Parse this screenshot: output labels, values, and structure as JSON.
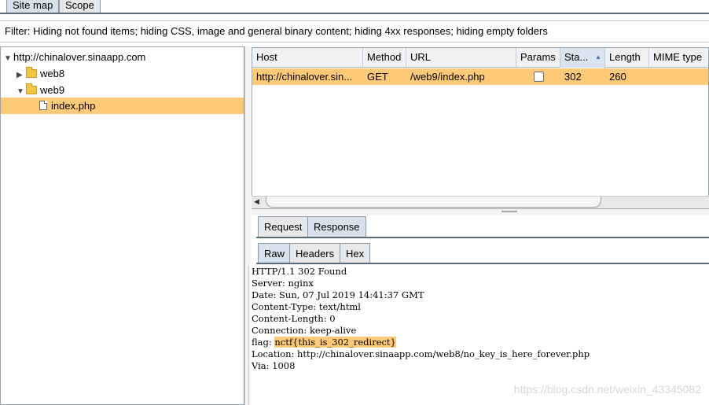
{
  "top_tabs": {
    "site_map": "Site map",
    "scope": "Scope"
  },
  "filter": "Filter: Hiding not found items;  hiding CSS, image and general binary content;  hiding 4xx responses;  hiding empty folders",
  "tree": {
    "root": "http://chinalover.sinaapp.com",
    "folders": [
      "web8",
      "web9"
    ],
    "file": "index.php"
  },
  "table": {
    "columns": [
      "Host",
      "Method",
      "URL",
      "Params",
      "Sta...",
      "Length",
      "MIME type"
    ],
    "row": {
      "host": "http://chinalover.sin...",
      "method": "GET",
      "url": "/web9/index.php",
      "status": "302",
      "length": "260"
    }
  },
  "req_tabs": {
    "request": "Request",
    "response": "Response"
  },
  "view_tabs": {
    "raw": "Raw",
    "headers": "Headers",
    "hex": "Hex"
  },
  "response": {
    "status_line": "HTTP/1.1 302 Found",
    "server": "Server: nginx",
    "date": "Date: Sun, 07 Jul 2019 14:41:37 GMT",
    "content_type": "Content-Type: text/html",
    "content_length": "Content-Length: 0",
    "connection": "Connection: keep-alive",
    "flag_label": "flag: ",
    "flag_value": "nctf{this_is_302_redirect}",
    "location": "Location: http://chinalover.sinaapp.com/web8/no_key_is_here_forever.php",
    "via": "Via: 1008"
  },
  "watermark": "https://blog.csdn.net/weixin_43345082"
}
